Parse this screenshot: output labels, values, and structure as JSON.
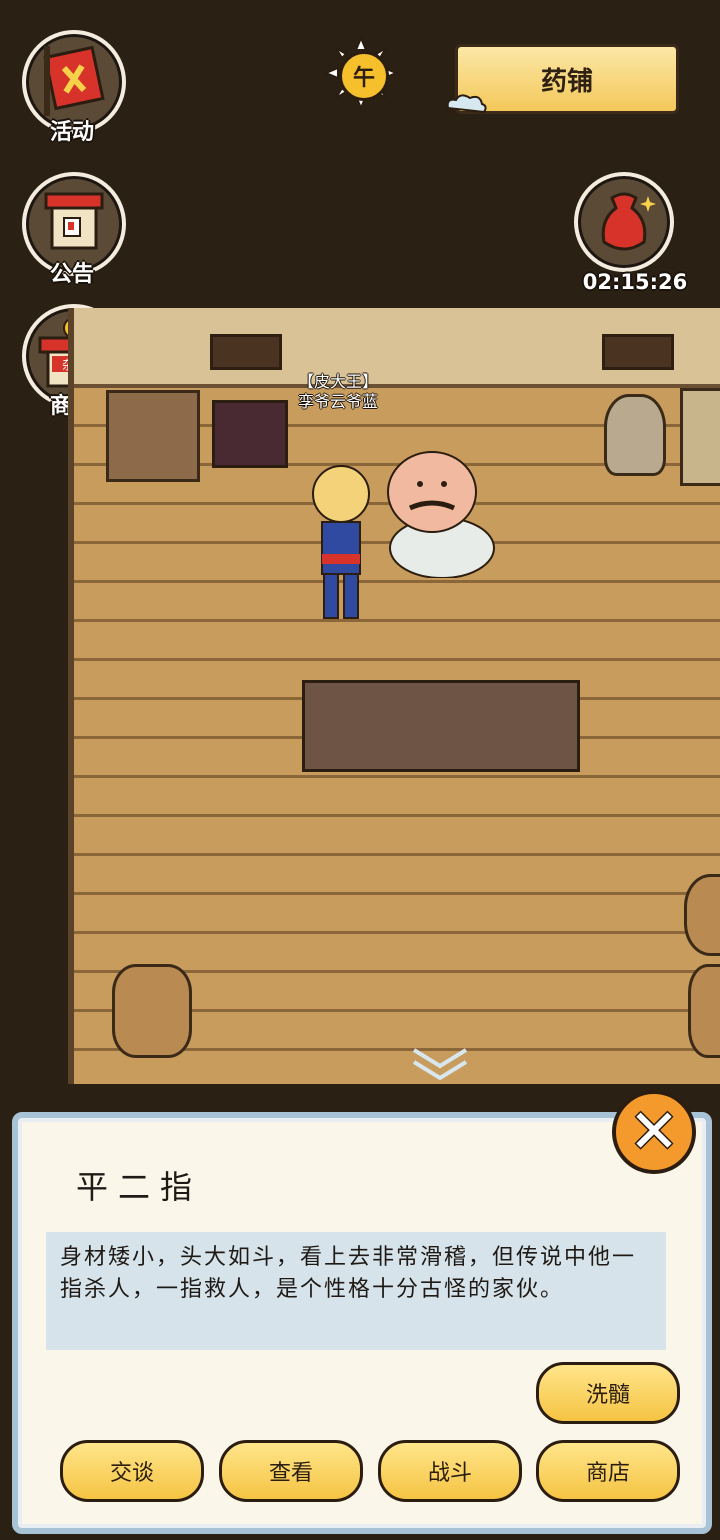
{
  "menu": {
    "activity": "活动",
    "notice": "公告",
    "mall": "商城",
    "mall_sign": "杂货"
  },
  "time_of_day": "午",
  "location_title": "药铺",
  "reward_timer": "02:15:26",
  "npc_tag": {
    "title": "【皮大王】",
    "name": "孪爷云爷蓝"
  },
  "dialog": {
    "npc_name": "平二指",
    "description": "身材矮小，头大如斗，看上去非常滑稽，但传说中他一指杀人，一指救人，是个性格十分古怪的家伙。",
    "buttons": {
      "xisui": "洗髓",
      "talk": "交谈",
      "view": "查看",
      "fight": "战斗",
      "shop": "商店"
    }
  },
  "colors": {
    "button_yellow": "#f5c443",
    "close_orange": "#f49a2c",
    "dialog_border": "#a8c3d6"
  }
}
